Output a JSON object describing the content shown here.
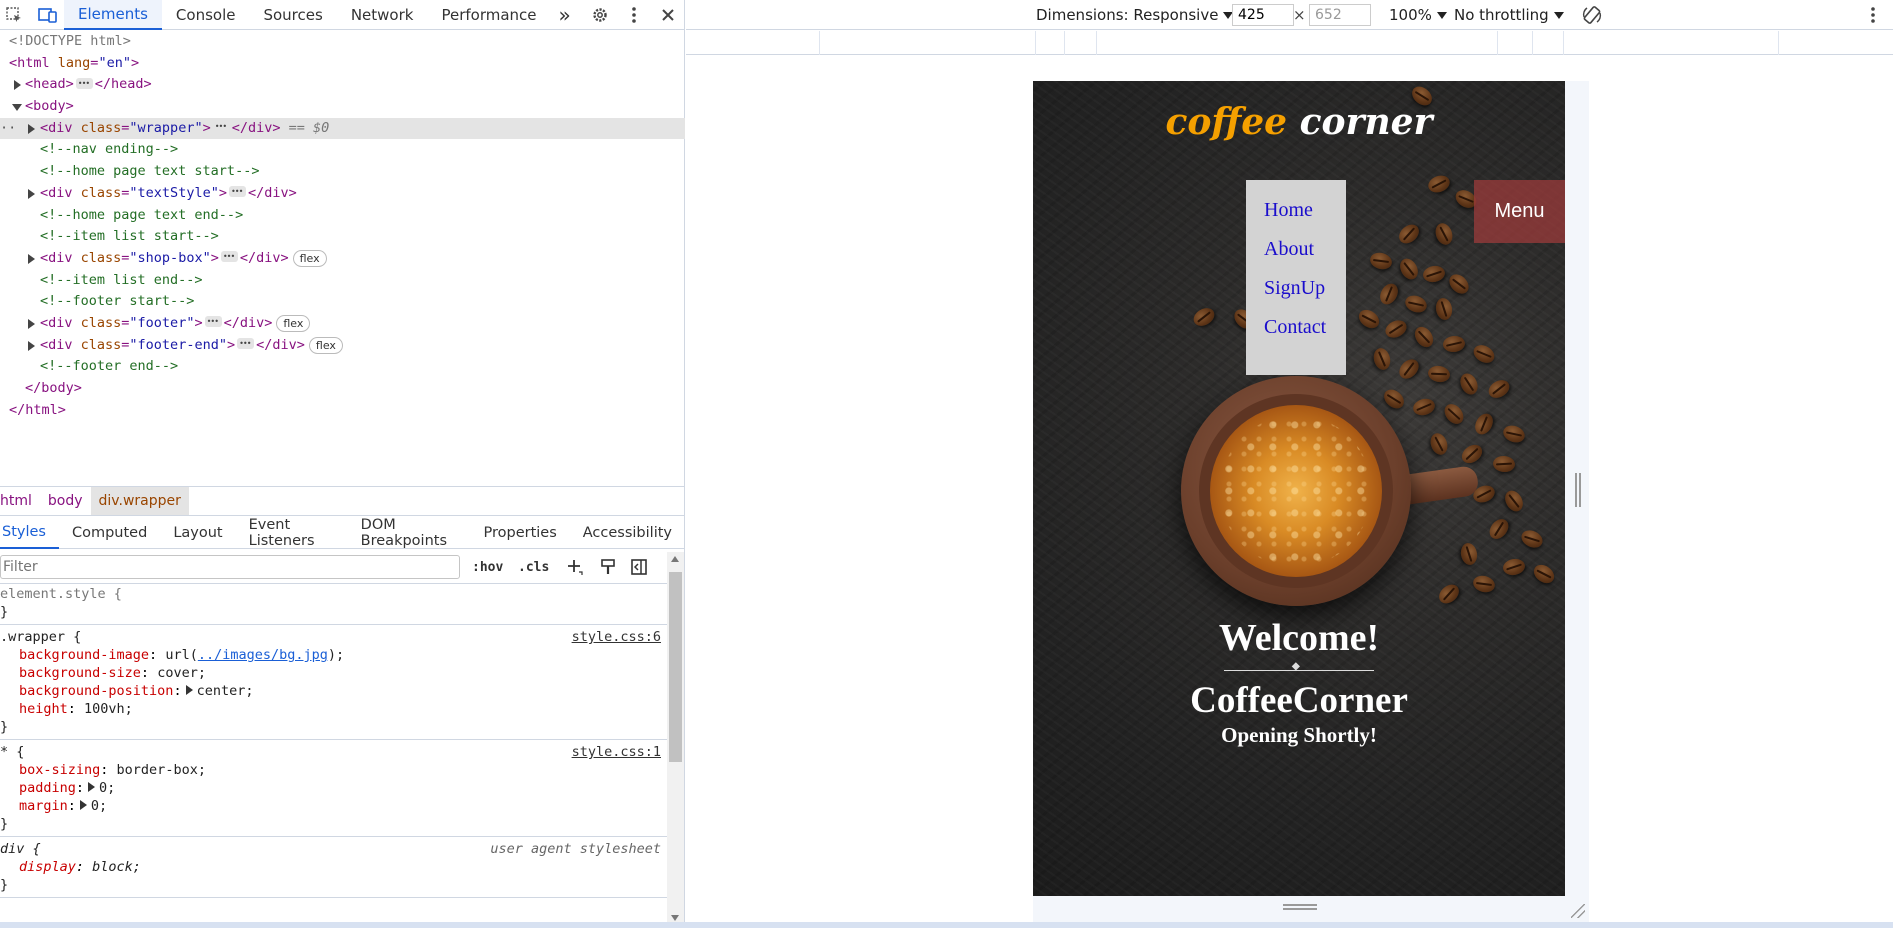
{
  "toolbar": {
    "tabs": [
      "Elements",
      "Console",
      "Sources",
      "Network",
      "Performance"
    ],
    "more_tabs": "»"
  },
  "dom": {
    "lines": [
      {
        "text_a": "<!DOCTYPE html>"
      },
      {
        "tag_open": "<html ",
        "attr": "lang",
        "val": "\"en\"",
        "tag_close": ">"
      },
      {
        "head": "<head>",
        "head_end": "</head>"
      },
      {
        "text": "<body>"
      },
      {
        "open": "<div ",
        "attr": "class",
        "val": "\"wrapper\"",
        "close": ">",
        "end": "</div>",
        "eq": "== $0"
      },
      {
        "comment": "<!--nav ending-->"
      },
      {
        "comment": "<!--home page text start-->"
      },
      {
        "open": "<div ",
        "attr": "class",
        "val": "\"textStyle\"",
        "close": ">",
        "end": "</div>"
      },
      {
        "comment": "<!--home page text end-->"
      },
      {
        "comment": "<!--item list start-->"
      },
      {
        "open": "<div ",
        "attr": "class",
        "val": "\"shop-box\"",
        "close": ">",
        "end": "</div>",
        "badge": "flex"
      },
      {
        "comment": "<!--item list end-->"
      },
      {
        "comment": "<!--footer start-->"
      },
      {
        "open": "<div ",
        "attr": "class",
        "val": "\"footer\"",
        "close": ">",
        "end": "</div>",
        "badge": "flex"
      },
      {
        "open": "<div ",
        "attr": "class",
        "val": "\"footer-end\"",
        "close": ">",
        "end": "</div>",
        "badge": "flex"
      },
      {
        "comment": "<!--footer end-->"
      },
      {
        "text": "</body>"
      },
      {
        "text": "</html>"
      }
    ]
  },
  "breadcrumbs": [
    "html",
    "body",
    "div.wrapper"
  ],
  "styles_tabs": [
    "Styles",
    "Computed",
    "Layout",
    "Event Listeners",
    "DOM Breakpoints",
    "Properties",
    "Accessibility"
  ],
  "filter": {
    "placeholder": "Filter"
  },
  "filter_tools": {
    "hov": ":hov",
    "cls": ".cls"
  },
  "rules": {
    "element_style": "element.style {",
    "wrapper": {
      "selector": ".wrapper {",
      "source": "style.css:6",
      "bg_image_name": "background-image",
      "bg_image_pre": "url(",
      "bg_image_url": "../images/bg.jpg",
      "bg_image_post": ");",
      "bg_size_name": "background-size",
      "bg_size_val": "cover;",
      "bg_pos_name": "background-position",
      "bg_pos_val": "center;",
      "height_name": "height",
      "height_val": "100vh;"
    },
    "universal": {
      "selector": "* {",
      "source": "style.css:1",
      "bs_name": "box-sizing",
      "bs_val": "border-box;",
      "pad_name": "padding",
      "pad_val": "0;",
      "mar_name": "margin",
      "mar_val": "0;"
    },
    "div": {
      "selector": "div {",
      "source": "user agent stylesheet",
      "disp_name": "display",
      "disp_val": "block;"
    },
    "close_brace": "}"
  },
  "device_toolbar": {
    "dimensions_label": "Dimensions: Responsive",
    "width": "425",
    "height": "652",
    "times": "×",
    "zoom": "100%",
    "throttling": "No throttling"
  },
  "page": {
    "logo_part1": "coffee",
    "logo_part2": "corner",
    "nav": [
      "Home",
      "About",
      "SignUp",
      "Contact"
    ],
    "menu_button": "Menu",
    "welcome": "Welcome!",
    "brand": "CoffeeCorner",
    "tagline": "Opening Shortly!"
  },
  "colors": {
    "accent": "#1a5fd6",
    "logo_orange": "#f5a000",
    "nav_bg": "#d3d3d3",
    "menu_bg": "#a03c3c"
  }
}
